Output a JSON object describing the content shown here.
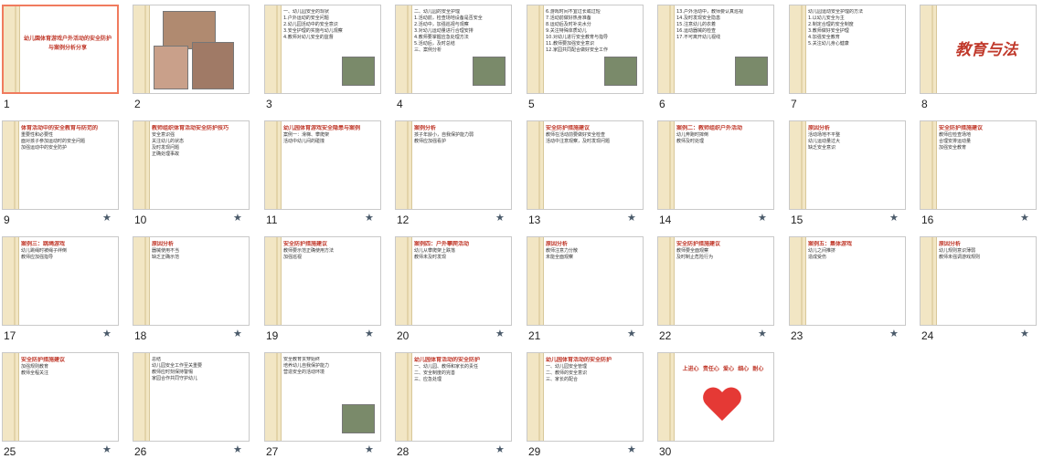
{
  "slides": [
    {
      "num": "1",
      "type": "title",
      "lines": [
        "幼儿園体育游戏户外活动的安全防护",
        "与案例分析分享"
      ]
    },
    {
      "num": "2",
      "type": "photos"
    },
    {
      "num": "3",
      "type": "bullets",
      "lines": [
        "一、幼儿园安全的现状",
        "1.户外运动的安全问题",
        "2.幼儿园活动中的安全意识",
        "3.安全护理的实施与幼儿观察",
        "4.教师对幼儿安全的监督"
      ]
    },
    {
      "num": "4",
      "type": "bullets",
      "lines": [
        "二、幼儿园的安全护理",
        "1.活动前，检查场地设备是否安全",
        "2.活动中，加强巡视与观察",
        "3.对幼儿运动量进行合理安排",
        "4.教师要掌握应急处理方法",
        "5.活动后，及时总结",
        "三、案例分析"
      ]
    },
    {
      "num": "5",
      "type": "bullets",
      "lines": [
        "6.游戏时间不宜过长或过短",
        "7.活动前做好热身准备",
        "8.运动后及时补充水分",
        "9.关注特殊体质幼儿",
        "10.对幼儿进行安全教育与指导",
        "11.教师要加强安全意识",
        "12.家园共同配合做好安全工作"
      ]
    },
    {
      "num": "6",
      "type": "bullets",
      "lines": [
        "13.户外活动中，教师要认真巡视",
        "14.及时发现安全隐患",
        "15.注意幼儿的衣着",
        "16.运动器械的检查",
        "17.不可离开幼儿视线"
      ]
    },
    {
      "num": "7",
      "type": "bullets",
      "lines": [
        "幼儿园运动安全护理的方法",
        "1.以幼儿安全为主",
        "2.制定合理的安全制度",
        "3.教师做好安全护理",
        "4.加强安全教育",
        "5.关注幼儿身心健康"
      ]
    },
    {
      "num": "8",
      "type": "bigtitle",
      "title": "教育与法"
    },
    {
      "num": "9",
      "type": "text",
      "lines": [
        "体育活动中的安全教育与防范的",
        "重要性和必要性",
        "面对孩子参加运动时的安全问题",
        "加强运动中的安全防护"
      ],
      "star": true
    },
    {
      "num": "10",
      "type": "text",
      "lines": [
        "教师组织体育活动安全防护技巧",
        "安全意识强",
        "关注幼儿的状态",
        "及时发现问题",
        "正确处理事故"
      ],
      "star": true
    },
    {
      "num": "11",
      "type": "text",
      "lines": [
        "幼儿园体育游戏安全隐患与案例",
        "案例一：滑梯、攀爬架",
        "活动中幼儿间的碰撞"
      ],
      "star": true
    },
    {
      "num": "12",
      "type": "text",
      "lines": [
        "案例分析",
        "孩子年龄小，自我保护能力弱",
        "教师应加强看护"
      ],
      "star": true
    },
    {
      "num": "13",
      "type": "text",
      "lines": [
        "安全防护措施建议",
        "教师在活动前要做好安全检查",
        "活动中注意观察，及时发现问题"
      ],
      "star": true
    },
    {
      "num": "14",
      "type": "text",
      "lines": [
        "案例二：教师组织户外活动",
        "幼儿奔跑时摔倒",
        "教师及时处理"
      ],
      "star": true
    },
    {
      "num": "15",
      "type": "text",
      "lines": [
        "原因分析",
        "活动场地不平整",
        "幼儿运动量过大",
        "缺乏安全意识"
      ],
      "star": true
    },
    {
      "num": "16",
      "type": "text",
      "lines": [
        "安全防护措施建议",
        "教师应检查场地",
        "合理安排运动量",
        "加强安全教育"
      ],
      "star": true
    },
    {
      "num": "17",
      "type": "text",
      "lines": [
        "案例三：跳绳游戏",
        "幼儿跳绳时被绳子绊倒",
        "教师应加强指导"
      ],
      "star": true
    },
    {
      "num": "18",
      "type": "text",
      "lines": [
        "原因分析",
        "器械使用不当",
        "缺乏正确示范"
      ],
      "star": true
    },
    {
      "num": "19",
      "type": "text",
      "lines": [
        "安全防护措施建议",
        "教师要示范正确使用方法",
        "加强巡视"
      ],
      "star": true
    },
    {
      "num": "20",
      "type": "text",
      "lines": [
        "案例四：户外攀爬活动",
        "幼儿从攀爬架上跌落",
        "教师未及时发现"
      ],
      "star": true
    },
    {
      "num": "21",
      "type": "text",
      "lines": [
        "原因分析",
        "教师注意力分散",
        "未能全面观察"
      ],
      "star": true
    },
    {
      "num": "22",
      "type": "text",
      "lines": [
        "安全防护措施建议",
        "教师要全面观察",
        "及时制止危险行为"
      ],
      "star": true
    },
    {
      "num": "23",
      "type": "text",
      "lines": [
        "案例五：集体游戏",
        "幼儿之间推挤",
        "造成受伤"
      ],
      "star": true
    },
    {
      "num": "24",
      "type": "text",
      "lines": [
        "原因分析",
        "幼儿规则意识薄弱",
        "教师未强调游戏规则"
      ],
      "star": true
    },
    {
      "num": "25",
      "type": "text",
      "lines": [
        "安全防护措施建议",
        "加强规则教育",
        "教师全程关注"
      ],
      "star": true
    },
    {
      "num": "26",
      "type": "bullets",
      "lines": [
        "总结",
        "幼儿园安全工作至关重要",
        "教师应时刻保持警惕",
        "家园合作共同守护幼儿"
      ],
      "star": true
    },
    {
      "num": "27",
      "type": "bullets",
      "lines": [
        "安全教育贯穿始终",
        "培养幼儿自我保护能力",
        "营造安全的活动环境"
      ],
      "star": true
    },
    {
      "num": "28",
      "type": "text",
      "lines": [
        "幼儿园体育活动的安全防护",
        "一、幼儿园、教师和家长的责任",
        "二、安全制度的完善",
        "三、应急处理"
      ],
      "star": true
    },
    {
      "num": "29",
      "type": "text",
      "lines": [
        "幼儿园体育活动的安全防护",
        "一、幼儿园安全管理",
        "二、教师的安全意识",
        "三、家长的配合"
      ],
      "star": true
    },
    {
      "num": "30",
      "type": "heart",
      "lines": [
        "上进心  责任心  爱心  细心  耐心"
      ],
      "star": false
    }
  ]
}
